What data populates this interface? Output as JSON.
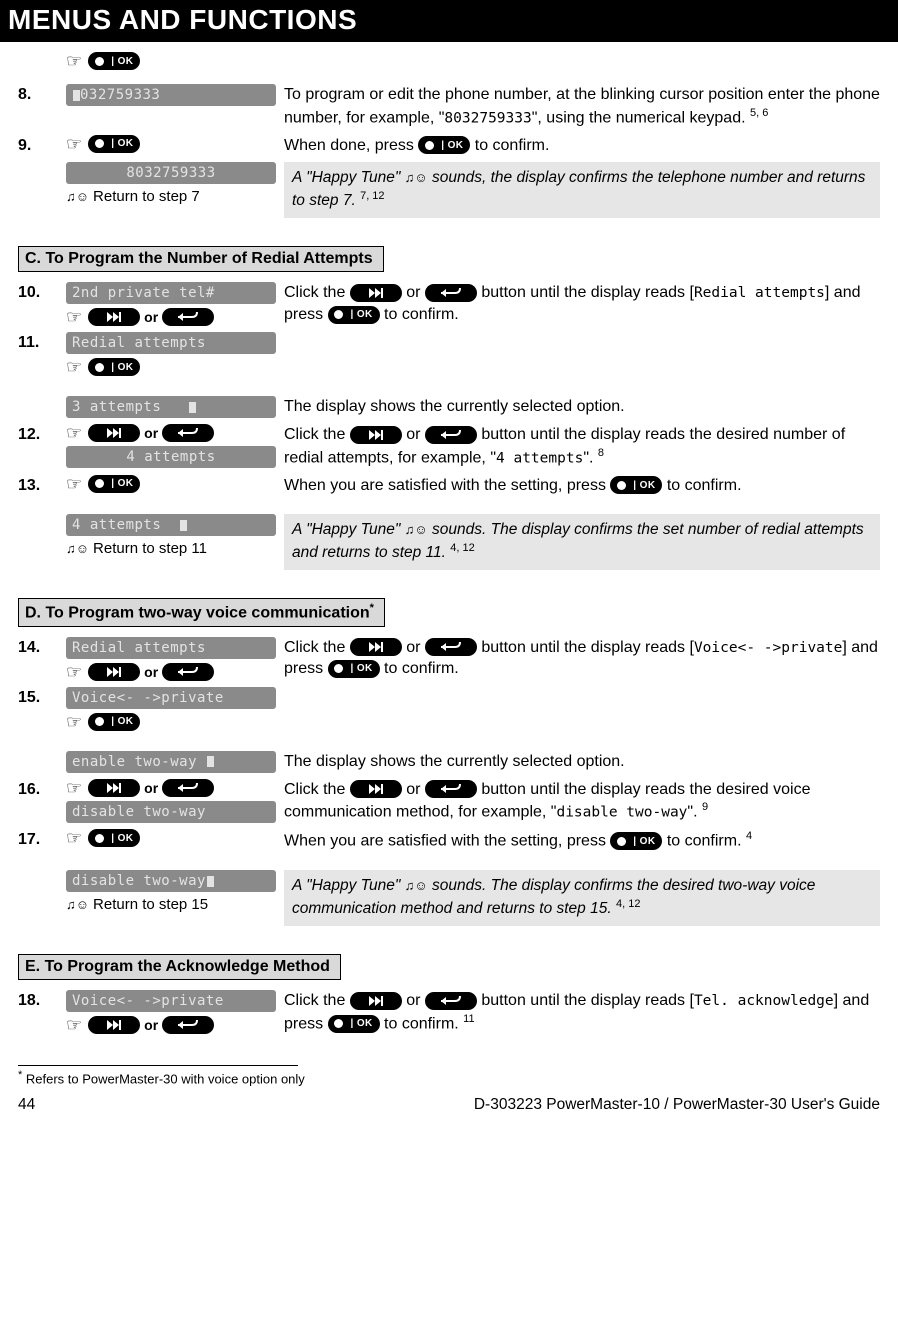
{
  "header": {
    "title": "MENUS AND FUNCTIONS"
  },
  "btn": {
    "ok_label": "| OK",
    "or": "or"
  },
  "step8": {
    "num": "8.",
    "lcd": "032759333",
    "text_a": "To program or edit the phone number, at the blinking cursor position enter the phone number, for example, \"",
    "sample": "8032759333",
    "text_b": "\", using the numerical keypad.",
    "sup": "5, 6"
  },
  "step9": {
    "num": "9.",
    "text_a": "When done, press ",
    "text_b": " to confirm.",
    "lcd": "8032759333",
    "return": "Return to step 7",
    "result_a": "A \"Happy Tune\" ",
    "result_b": " sounds, the display confirms the telephone number and returns to step 7.",
    "sup": "7, 12"
  },
  "sectionC": {
    "title": "C. To Program the Number of Redial Attempts"
  },
  "step10": {
    "num": "10.",
    "lcd": "2nd private tel#",
    "text_a": "Click the ",
    "text_mid": " or ",
    "text_b": " button until the display reads [",
    "code": "Redial attempts",
    "text_c": "] and press ",
    "text_d": " to confirm."
  },
  "step11": {
    "num": "11.",
    "lcd": "Redial attempts"
  },
  "stepPre12": {
    "lcd": "3 attempts",
    "text": "The display shows the currently selected option."
  },
  "step12": {
    "num": "12.",
    "lcd": "4 attempts",
    "text_a": "Click the ",
    "text_mid": " or ",
    "text_b": " button until the display reads the desired number of redial attempts, for example, \"",
    "code": "4 attempts",
    "text_c": "\".",
    "sup": "8"
  },
  "step13": {
    "num": "13.",
    "text_a": "When you are satisfied with the setting, press ",
    "text_b": " to confirm.",
    "lcd": "4 attempts",
    "return": "Return to step 11",
    "result_a": "A \"Happy Tune\" ",
    "result_b": " sounds. The display confirms the set number of redial attempts and returns to step 11.",
    "sup": "4, 12"
  },
  "sectionD": {
    "title_a": "D. To Program two-way voice communication",
    "star": "*"
  },
  "step14": {
    "num": "14.",
    "lcd": "Redial attempts",
    "text_a": "Click the ",
    "text_mid": " or ",
    "text_b": " button until the display reads [",
    "code": "Voice<- ->private",
    "text_c": "] and press ",
    "text_d": " to confirm."
  },
  "step15": {
    "num": "15.",
    "lcd": "Voice<- ->private"
  },
  "stepPre16": {
    "lcd": "enable two-way",
    "text": "The display shows the currently selected option."
  },
  "step16": {
    "num": "16.",
    "lcd": "disable two-way",
    "text_a": "Click the ",
    "text_mid": " or ",
    "text_b": " button until the display reads the desired voice communication method, for example, \"",
    "code": "disable two-way",
    "text_c": "\".",
    "sup": "9"
  },
  "step17": {
    "num": "17.",
    "text_a": "When you are satisfied with the setting, press ",
    "text_b": " to confirm.",
    "sup0": "4",
    "lcd": "disable two-way",
    "return": "Return to step 15",
    "result_a": "A \"Happy Tune\" ",
    "result_b": " sounds. The display confirms the desired two-way voice communication method and returns to step 15.",
    "sup": "4, 12"
  },
  "sectionE": {
    "title": "E. To Program the Acknowledge Method"
  },
  "step18": {
    "num": "18.",
    "lcd": "Voice<- ->private",
    "text_a": "Click the ",
    "text_mid": " or ",
    "text_b": " button until the display reads [",
    "code": "Tel. acknowledge",
    "text_c": "] and press ",
    "text_d": " to confirm.",
    "sup": "11"
  },
  "footnote": {
    "star": "*",
    "text": " Refers to PowerMaster-30 with voice option only"
  },
  "footer": {
    "page": "44",
    "doc": "D-303223 PowerMaster-10 / PowerMaster-30 User's Guide"
  },
  "tune_glyph": "♫☺"
}
